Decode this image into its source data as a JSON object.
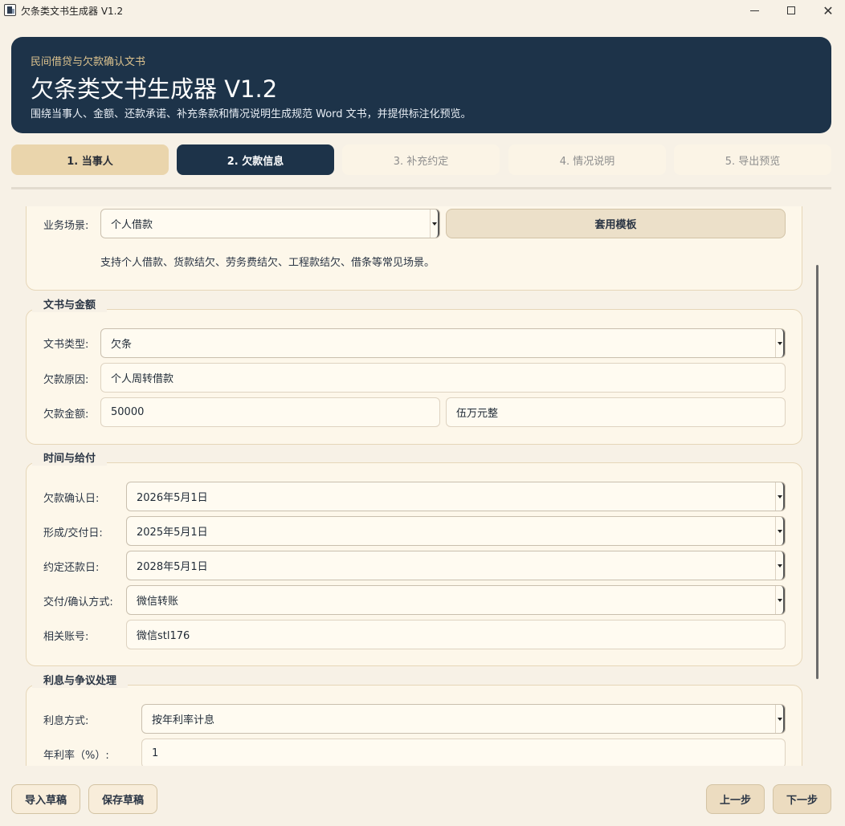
{
  "window": {
    "title": "欠条类文书生成器 V1.2"
  },
  "header": {
    "kicker": "民间借贷与欠款确认文书",
    "title": "欠条类文书生成器 V1.2",
    "subtitle": "围绕当事人、金额、还款承诺、补充条款和情况说明生成规范 Word 文书，并提供标注化预览。"
  },
  "steps": [
    {
      "label": "1. 当事人",
      "state": "completed"
    },
    {
      "label": "2. 欠款信息",
      "state": "active"
    },
    {
      "label": "3. 补充约定",
      "state": "pending"
    },
    {
      "label": "4. 情况说明",
      "state": "pending"
    },
    {
      "label": "5. 导出预览",
      "state": "pending"
    }
  ],
  "scenario": {
    "label": "业务场景:",
    "value": "个人借款",
    "apply_button": "套用模板",
    "hint": "支持个人借款、货款结欠、劳务费结欠、工程款结欠、借条等常见场景。"
  },
  "doc_amount": {
    "title": "文书与金额",
    "doc_type_label": "文书类型:",
    "doc_type_value": "欠条",
    "reason_label": "欠款原因:",
    "reason_value": "个人周转借款",
    "amount_label": "欠款金额:",
    "amount_value": "50000",
    "amount_upper": "伍万元整"
  },
  "time_payment": {
    "title": "时间与给付",
    "confirm_date_label": "欠款确认日:",
    "confirm_date_value": "2026年5月1日",
    "formed_date_label": "形成/交付日:",
    "formed_date_value": "2025年5月1日",
    "due_date_label": "约定还款日:",
    "due_date_value": "2028年5月1日",
    "method_label": "交付/确认方式:",
    "method_value": "微信转账",
    "account_label": "相关账号:",
    "account_value": "微信stl176"
  },
  "interest": {
    "title": "利息与争议处理",
    "mode_label": "利息方式:",
    "mode_value": "按年利率计息",
    "rate_label": "年利率（%）:",
    "rate_value": "1"
  },
  "footer": {
    "import_label": "导入草稿",
    "save_label": "保存草稿",
    "prev_label": "上一步",
    "next_label": "下一步"
  }
}
